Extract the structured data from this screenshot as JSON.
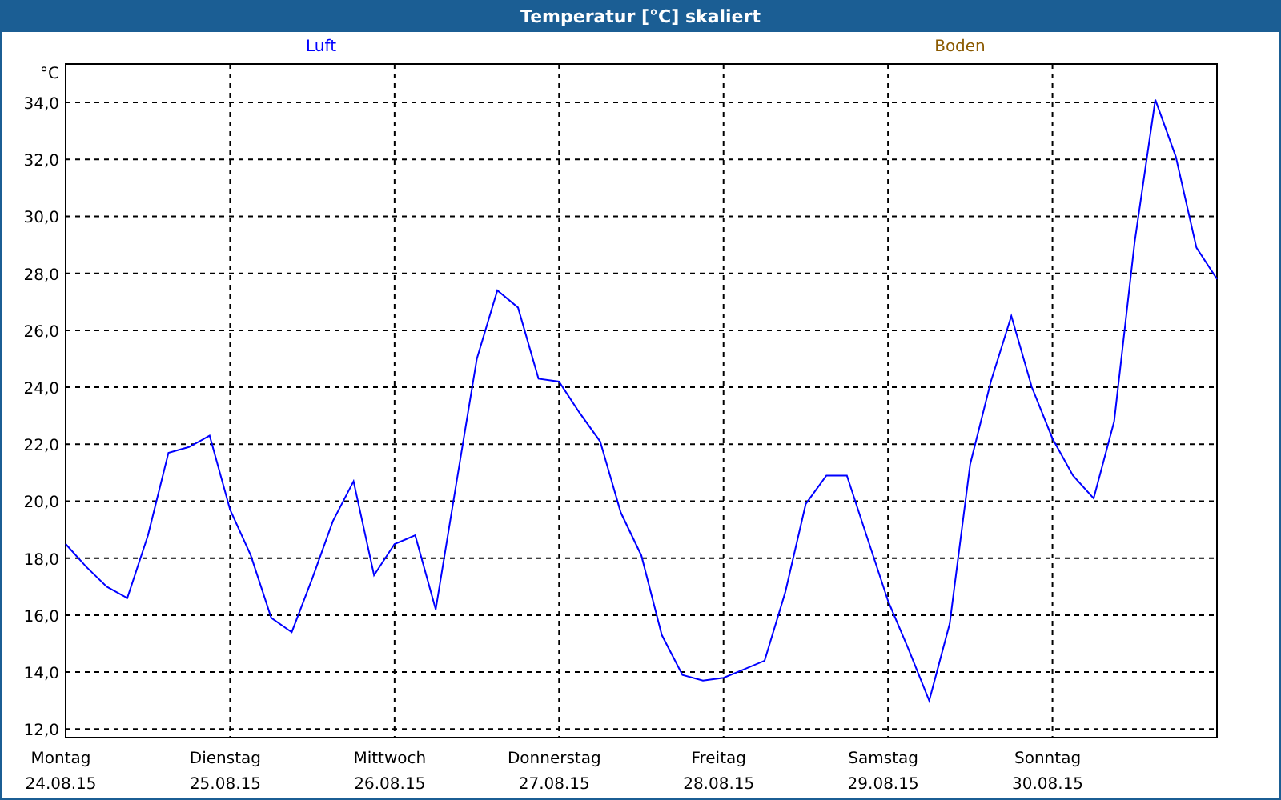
{
  "day_dates": [
    "24.08.15",
    "25.08.15",
    "26.08.15",
    "27.08.15",
    "28.08.15",
    "29.08.15",
    "30.08.15"
  ],
  "chart_data": {
    "type": "line",
    "grid": true,
    "title": "Temperatur [°C] skaliert",
    "ylabel": "°C",
    "ylim": [
      11.7,
      35.35
    ],
    "categories": [
      "Montag",
      null,
      null,
      null,
      null,
      null,
      null,
      null,
      "Dienstag",
      null,
      null,
      null,
      null,
      null,
      null,
      null,
      "Mittwoch",
      null,
      null,
      null,
      null,
      null,
      null,
      null,
      "Donnerstag",
      null,
      null,
      null,
      null,
      null,
      null,
      null,
      "Freitag",
      null,
      null,
      null,
      null,
      null,
      null,
      null,
      "Samstag",
      null,
      null,
      null,
      null,
      null,
      null,
      null,
      "Sonntag",
      null,
      null,
      null,
      null,
      null,
      null,
      null,
      null
    ],
    "yticks": [
      {
        "value": 12,
        "label": "12,0"
      },
      {
        "value": 14,
        "label": "14,0"
      },
      {
        "value": 16,
        "label": "16,0"
      },
      {
        "value": 18,
        "label": "18,0"
      },
      {
        "value": 20,
        "label": "20,0"
      },
      {
        "value": 22,
        "label": "22,0"
      },
      {
        "value": 24,
        "label": "24,0"
      },
      {
        "value": 26,
        "label": "26,0"
      },
      {
        "value": 28,
        "label": "28,0"
      },
      {
        "value": 30,
        "label": "30,0"
      },
      {
        "value": 32,
        "label": "32,0"
      },
      {
        "value": 34,
        "label": "34,0"
      }
    ],
    "series": [
      {
        "name": "Luft",
        "color": "#0000ff",
        "values": [
          18.5,
          17.7,
          17.0,
          16.6,
          18.8,
          21.7,
          21.9,
          22.3,
          19.7,
          18.1,
          15.9,
          15.4,
          17.3,
          19.3,
          20.7,
          17.4,
          18.5,
          18.8,
          16.2,
          20.6,
          25.0,
          27.4,
          26.8,
          24.3,
          24.2,
          23.1,
          22.1,
          19.6,
          18.1,
          15.3,
          13.9,
          13.7,
          13.8,
          14.1,
          14.4,
          16.8,
          19.9,
          20.9,
          20.9,
          18.7,
          16.5,
          14.8,
          13.0,
          15.7,
          21.3,
          24.2,
          26.5,
          24.0,
          22.2,
          20.9,
          20.1,
          22.8,
          29.1,
          34.1,
          32.1,
          28.9,
          27.8
        ]
      },
      {
        "name": "Boden",
        "color": "#8b5a00",
        "values": [
          null,
          null,
          null,
          null,
          null,
          null,
          null,
          null,
          null,
          null,
          null,
          null,
          null,
          null,
          null,
          null,
          null,
          null,
          null,
          null,
          null,
          null,
          null,
          null,
          null,
          null,
          null,
          null,
          null,
          null,
          null,
          null,
          null,
          null,
          null,
          null,
          null,
          null,
          null,
          null,
          null,
          null,
          null,
          null,
          null,
          null,
          null,
          null,
          null,
          null,
          null,
          null,
          null,
          null,
          null,
          null,
          null
        ]
      }
    ]
  }
}
